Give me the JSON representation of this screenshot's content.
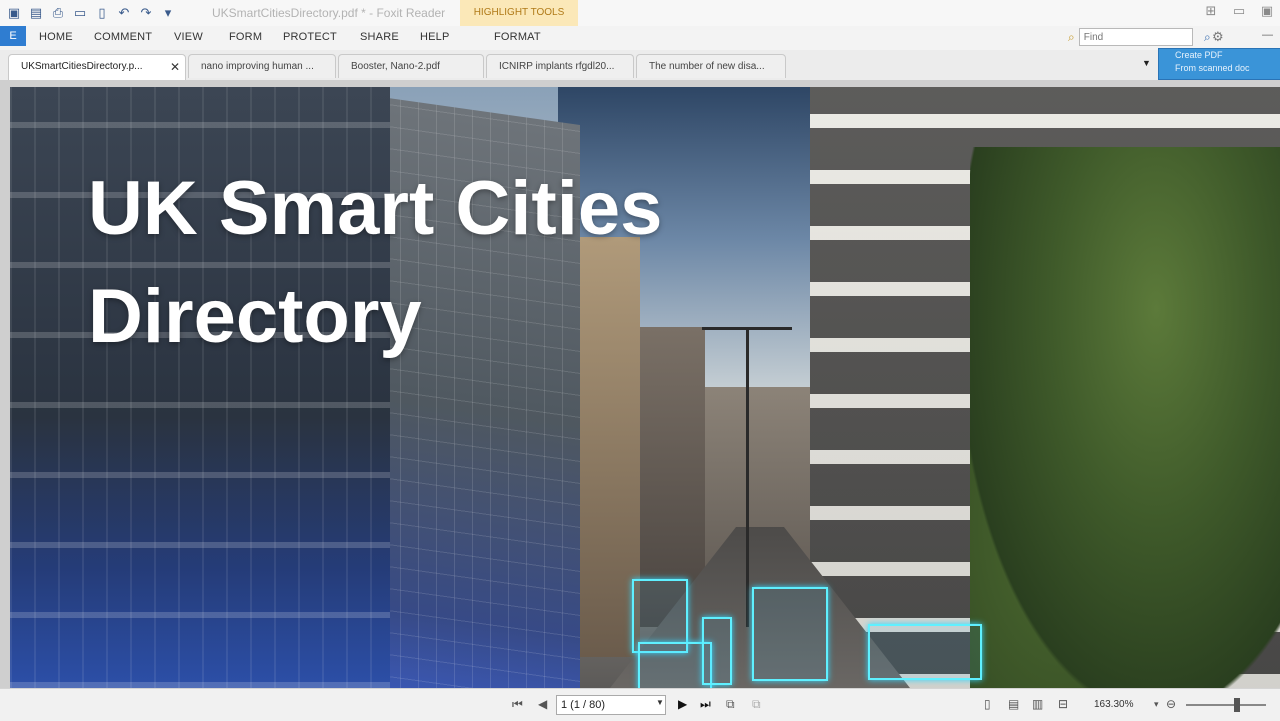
{
  "window": {
    "title": "UKSmartCitiesDirectory.pdf * - Foxit Reader",
    "contextual_tab": "HIGHLIGHT TOOLS"
  },
  "quick_access": {
    "icons": [
      "app-icon",
      "save-icon",
      "print-icon",
      "scan-icon",
      "new-icon",
      "undo-icon",
      "redo-icon",
      "customize-icon"
    ]
  },
  "menu": {
    "file_label": "E",
    "items": [
      "HOME",
      "COMMENT",
      "VIEW",
      "FORM",
      "PROTECT",
      "SHARE",
      "HELP",
      "FORMAT"
    ]
  },
  "find": {
    "placeholder": "Find"
  },
  "tabs": [
    {
      "label": "UKSmartCitiesDirectory.p...",
      "active": true
    },
    {
      "label": "nano improving human ...",
      "active": false
    },
    {
      "label": "Booster, Nano-2.pdf",
      "active": false
    },
    {
      "label": "ICNIRP implants rfgdl20...",
      "active": false
    },
    {
      "label": "The number of new disa...",
      "active": false
    }
  ],
  "popup": {
    "line1": "Create PDF",
    "line2": "From scanned doc"
  },
  "document": {
    "title_line1": "UK Smart Cities",
    "title_line2": "Directory"
  },
  "status": {
    "page_indicator": "1 (1 / 80)",
    "zoom": "163.30%"
  },
  "colors": {
    "accent": "#2f7dd1",
    "highlight_tools": "#fbe8b8",
    "popup": "#3a94d8",
    "title_text": "#ffffff"
  }
}
